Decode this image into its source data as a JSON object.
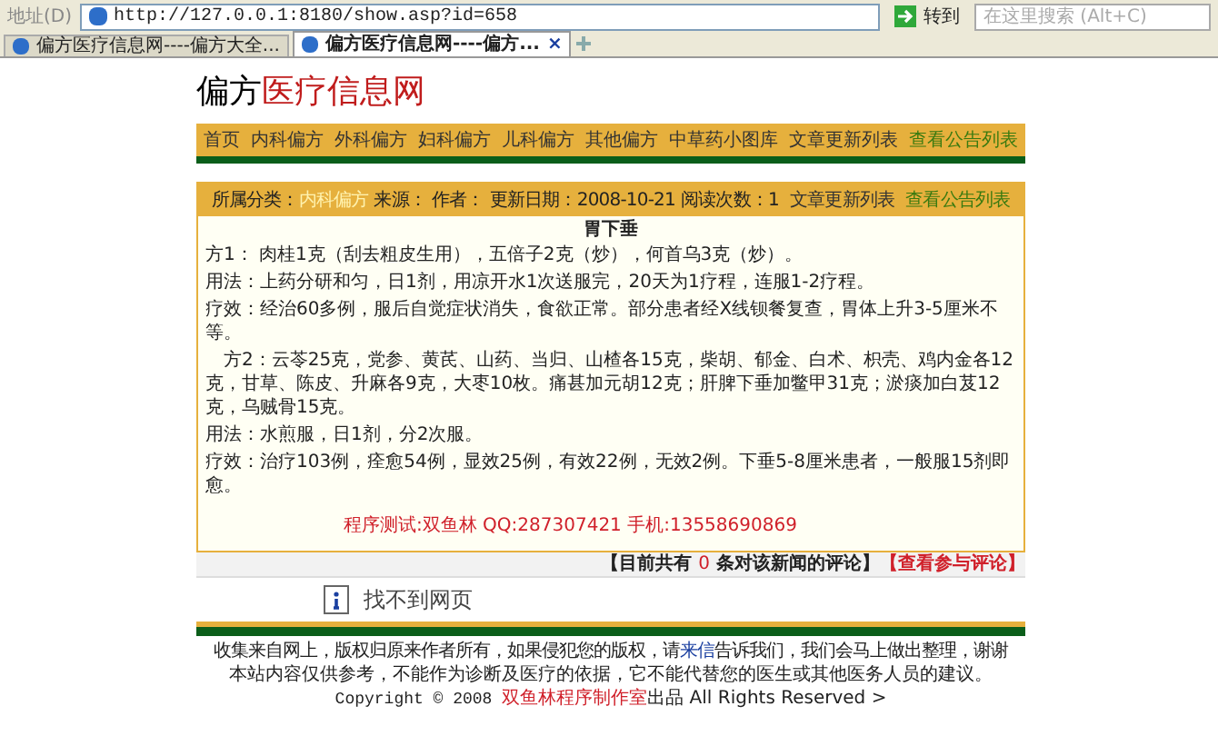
{
  "browser": {
    "address_label": "地址(D)",
    "url": "http://127.0.0.1:8180/show.asp?id=658",
    "go_button": "转到",
    "search": {
      "placeholder": "在这里搜索 (Alt+C)"
    },
    "tabs": [
      {
        "label": "偏方医疗信息网----偏方大全...",
        "selected": false
      },
      {
        "label": "偏方医疗信息网----偏方...",
        "selected": true,
        "close": "×"
      }
    ]
  },
  "logo": {
    "part1": "偏方",
    "part2": "医疗信息网"
  },
  "nav": [
    {
      "label": "首页",
      "color": "#333333"
    },
    {
      "label": "内科偏方",
      "color": "#333333"
    },
    {
      "label": "外科偏方",
      "color": "#333333"
    },
    {
      "label": "妇科偏方",
      "color": "#333333"
    },
    {
      "label": "儿科偏方",
      "color": "#333333"
    },
    {
      "label": "其他偏方",
      "color": "#333333"
    },
    {
      "label": "中草药小图库",
      "color": "#333333"
    },
    {
      "label": "文章更新列表",
      "color": "#333333"
    },
    {
      "label": "查看公告列表",
      "color": "#3a7a10"
    }
  ],
  "article": {
    "meta": [
      {
        "label": "所属分类：",
        "value": "内科偏方"
      },
      {
        "label": "来源："
      },
      {
        "label": "作者："
      },
      {
        "label": "更新日期：",
        "value": "2008-10-21"
      },
      {
        "label": "阅读次数：",
        "value": "1"
      }
    ],
    "links": [
      {
        "label": "文章更新列表",
        "color": "#333333"
      },
      {
        "label": "查看公告列表",
        "color": "#3a7a10"
      }
    ],
    "title": "胃下垂",
    "paragraphs": [
      "方1： 肉桂1克（刮去粗皮生用），五倍子2克（炒），何首乌3克（炒）。",
      "用法：上药分研和匀，日1剂，用凉开水1次送服完，20天为1疗程，连服1-2疗程。",
      "疗效：经治60多例，服后自觉症状消失，食欲正常。部分患者经X线钡餐复查，胃体上升3-5厘米不等。",
      "　方2：云苓25克，党参、黄芪、山药、当归、山楂各15克，柴胡、郁金、白术、枳壳、鸡内金各12克，甘草、陈皮、升麻各9克，大枣10枚。痛甚加元胡12克；肝脾下垂加鳖甲31克；淤痰加白芨12克，乌贼骨15克。",
      "用法：水煎服，日1剂，分2次服。",
      "疗效：治疗103例，痊愈54例，显效25例，有效22例，无效2例。下垂5-8厘米患者，一般服15剂即愈。"
    ],
    "credit": "程序测试:双鱼林 QQ:287307421 手机:13558690869"
  },
  "comments": {
    "before": "【目前共有",
    "count": "0",
    "after": "条对该新闻的评论】",
    "link": "【查看参与评论】"
  },
  "error_frame": {
    "title": "找不到网页"
  },
  "footer": {
    "line1_before": "收集来自网上，版权归原来作者所有，如果侵犯您的版权，请",
    "line1_link": "来信",
    "line1_after": "告诉我们，我们会马上做出整理，谢谢",
    "line2": "本站内容仅供参考，不能作为诊断及医疗的依据，它不能代替您的医生或其他医务人员的建议。",
    "copyright_before": "Copyright © 2008",
    "copyright_studio": "双鱼林程序制作室",
    "copyright_after": "出品 All Rights Reserved >"
  }
}
